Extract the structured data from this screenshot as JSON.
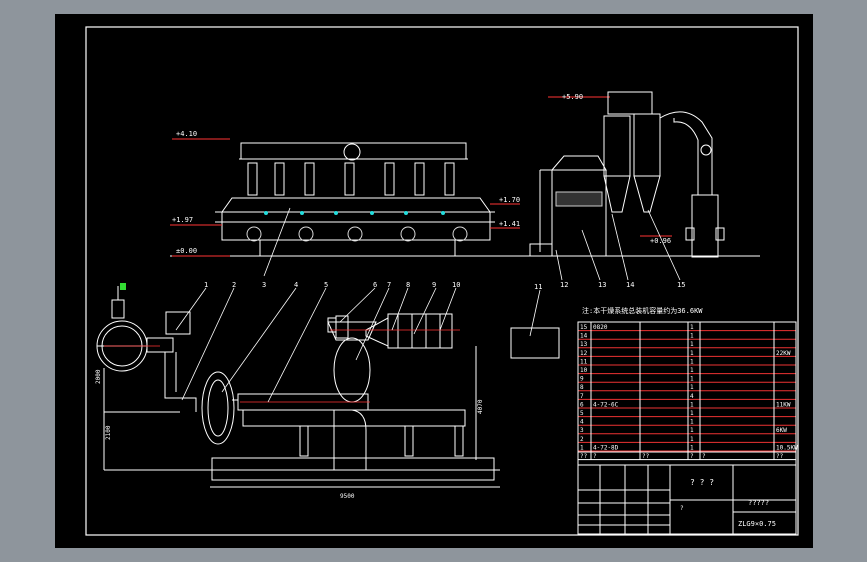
{
  "elevations": {
    "top": "+4.10",
    "mid": "+1.97",
    "base": "±0.00",
    "right_top": "+1.70",
    "right_low": "+1.41",
    "cyclone_top": "+5.90",
    "cyclone_low": "+0.96"
  },
  "callouts": [
    "1",
    "2",
    "3",
    "4",
    "5",
    "6",
    "7",
    "8",
    "9",
    "10",
    "11",
    "12",
    "13",
    "14",
    "15"
  ],
  "dimensions": {
    "plan_length": "9500",
    "height_a": "2000",
    "height_b": "2100",
    "height_c": "4070"
  },
  "note": "注:本干燥系统总装机容量约为36.6KW",
  "parts_table": {
    "rows": [
      {
        "no": "15",
        "code": "0820",
        "qty": "1",
        "spec": ""
      },
      {
        "no": "14",
        "code": "",
        "qty": "1",
        "spec": ""
      },
      {
        "no": "13",
        "code": "",
        "qty": "1",
        "spec": ""
      },
      {
        "no": "12",
        "code": "",
        "qty": "1",
        "spec": "22KW"
      },
      {
        "no": "11",
        "code": "",
        "qty": "1",
        "spec": ""
      },
      {
        "no": "10",
        "code": "",
        "qty": "1",
        "spec": ""
      },
      {
        "no": "9",
        "code": "",
        "qty": "1",
        "spec": ""
      },
      {
        "no": "8",
        "code": "",
        "qty": "1",
        "spec": ""
      },
      {
        "no": "7",
        "code": "",
        "qty": "4",
        "spec": ""
      },
      {
        "no": "6",
        "code": "4-72-6C",
        "qty": "1",
        "spec": "11KW"
      },
      {
        "no": "5",
        "code": "",
        "qty": "1",
        "spec": ""
      },
      {
        "no": "4",
        "code": "",
        "qty": "1",
        "spec": ""
      },
      {
        "no": "3",
        "code": "",
        "qty": "1",
        "spec": "6KW"
      },
      {
        "no": "2",
        "code": "",
        "qty": "1",
        "spec": ""
      },
      {
        "no": "1",
        "code": "4-72-8D",
        "qty": "1",
        "spec": "10.5KW"
      }
    ],
    "header": [
      "??",
      "?",
      "??",
      "?",
      "?",
      "??"
    ]
  },
  "title_block": {
    "company": "? ? ?",
    "drawing_name": "?????",
    "drawing_no": "ZLG9×0.75",
    "scale": "?"
  }
}
